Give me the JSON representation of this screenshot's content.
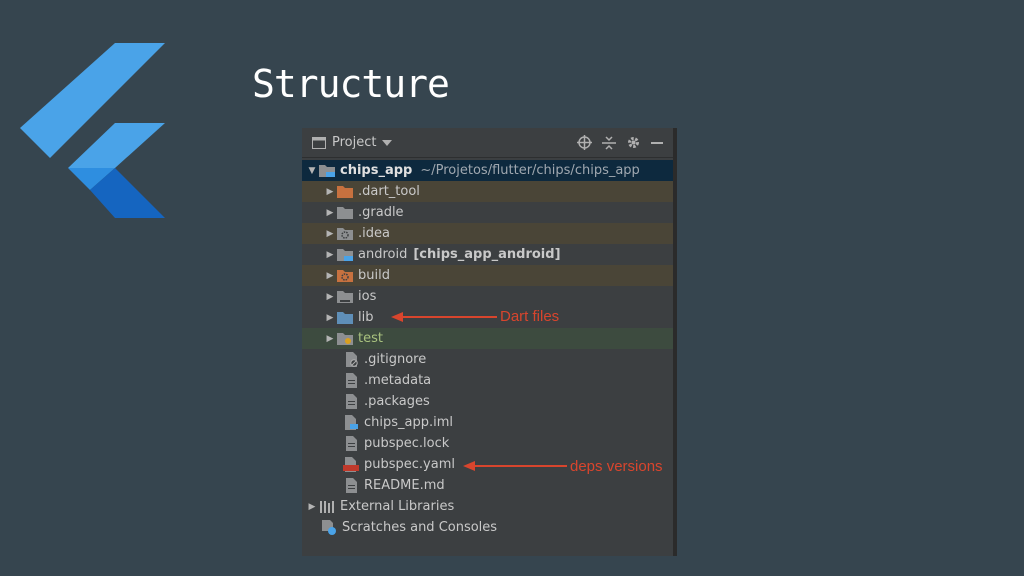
{
  "slide": {
    "title": "Structure"
  },
  "panel": {
    "view_label": "Project"
  },
  "tree": {
    "root": {
      "label": "chips_app",
      "path": "~/Projetos/flutter/chips/chips_app"
    },
    "folders": {
      "dart_tool": ".dart_tool",
      "gradle": ".gradle",
      "idea": ".idea",
      "android": "android",
      "android_module": "[chips_app_android]",
      "build": "build",
      "ios": "ios",
      "lib": "lib",
      "test": "test"
    },
    "files": {
      "gitignore": ".gitignore",
      "metadata": ".metadata",
      "packages": ".packages",
      "chips_app_iml": "chips_app.iml",
      "pubspec_lock": "pubspec.lock",
      "pubspec_yaml": "pubspec.yaml",
      "readme": "README.md"
    },
    "external_libraries": "External Libraries",
    "scratches": "Scratches and Consoles"
  },
  "annotations": {
    "lib": "Dart files",
    "yaml": "deps versions"
  },
  "colors": {
    "slide_bg": "#36454f",
    "panel_bg": "#3c3f41",
    "annotation": "#d8452d",
    "folder": "#8d8f91",
    "excluded_folder": "#c7713f",
    "source_folder": "#5f8fb8",
    "flutter_light": "#4aa3e8",
    "flutter_dark": "#1565c0"
  }
}
